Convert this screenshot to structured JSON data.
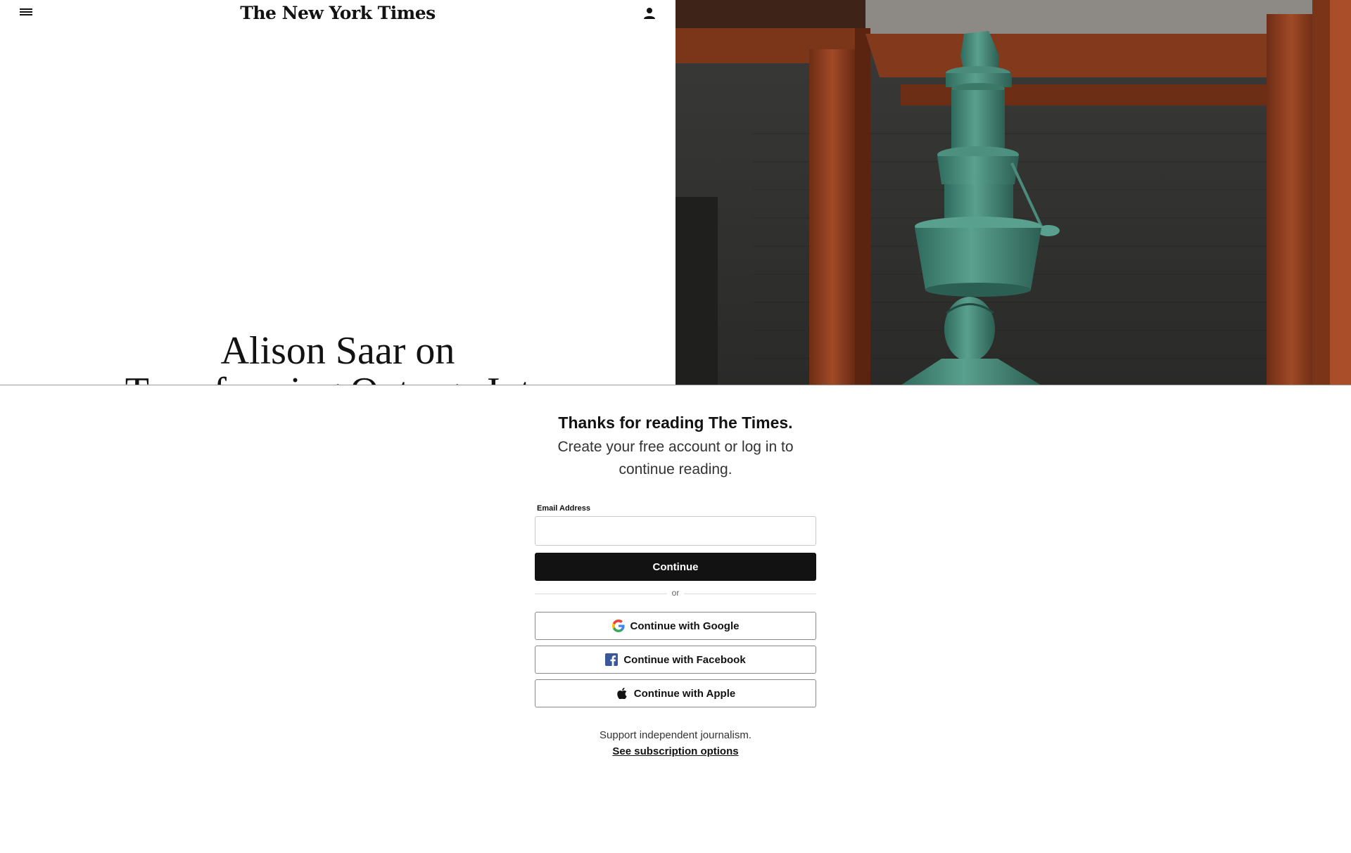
{
  "header": {
    "logo_text": "The New York Times",
    "menu_icon": "hamburger-menu-icon",
    "account_icon": "person-icon"
  },
  "article": {
    "headline_line1": "Alison Saar on",
    "headline_line2": "Transforming Outrage Into"
  },
  "modal": {
    "title": "Thanks for reading The Times.",
    "subtitle": "Create your free account or log in to continue reading.",
    "email_label": "Email Address",
    "email_value": "",
    "email_placeholder": "",
    "continue_label": "Continue",
    "divider_text": "or",
    "google_label": "Continue with Google",
    "facebook_label": "Continue with Facebook",
    "apple_label": "Continue with Apple",
    "support_text": "Support independent journalism.",
    "subscription_link": "See subscription options"
  },
  "colors": {
    "primary_button_bg": "#121212",
    "facebook_blue": "#3b5998",
    "sculpture_patina": "#4f8f7f",
    "wood_frame": "#8a3b20"
  }
}
